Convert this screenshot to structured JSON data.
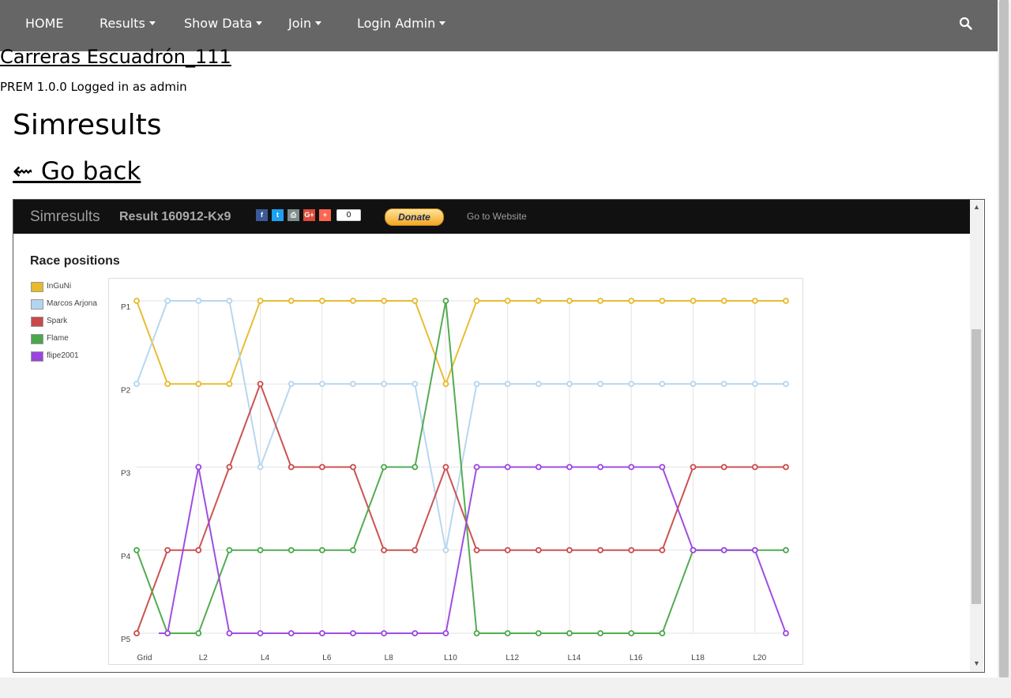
{
  "nav": {
    "items": [
      {
        "label": "HOME",
        "dropdown": false
      },
      {
        "label": "Results",
        "dropdown": true
      },
      {
        "label": "Show Data",
        "dropdown": true
      },
      {
        "label": "Join",
        "dropdown": true
      },
      {
        "label": "Login Admin",
        "dropdown": true
      }
    ],
    "search_icon": "search-icon"
  },
  "site": {
    "title": "Carreras Escuadrón_111",
    "status": "PREM 1.0.0  Logged in as admin"
  },
  "page": {
    "title": "Simresults",
    "go_back": "⇜ Go back"
  },
  "sim": {
    "brand": "Simresults",
    "result": "Result 160912-Kx9",
    "share_count": "0",
    "donate": "Donate",
    "go_website": "Go to Website",
    "share": [
      {
        "icon": "facebook-icon",
        "glyph": "f",
        "color": "#3b5998"
      },
      {
        "icon": "twitter-icon",
        "glyph": "t",
        "color": "#1da1f2"
      },
      {
        "icon": "print-icon",
        "glyph": "⎙",
        "color": "#7f8c8d"
      },
      {
        "icon": "google-plus-icon",
        "glyph": "G+",
        "color": "#dd4b39"
      },
      {
        "icon": "share-plus-icon",
        "glyph": "+",
        "color": "#ff6550"
      }
    ]
  },
  "chart_data": {
    "type": "line",
    "title": "Race positions",
    "x": [
      "Grid",
      "L1",
      "L2",
      "L3",
      "L4",
      "L5",
      "L6",
      "L7",
      "L8",
      "L9",
      "L10",
      "L11",
      "L12",
      "L13",
      "L14",
      "L15",
      "L16",
      "L17",
      "L18",
      "L19",
      "L20",
      "L21"
    ],
    "x_tick_labels": {
      "Grid": "Grid",
      "L2": "L2",
      "L4": "L4",
      "L6": "L6",
      "L8": "L8",
      "L10": "L10",
      "L12": "L12",
      "L14": "L14",
      "L16": "L16",
      "L18": "L18",
      "L20": "L20"
    },
    "y_tick_labels": [
      "P1",
      "P2",
      "P3",
      "P4",
      "P5"
    ],
    "ylim": [
      1,
      5
    ],
    "y_inverted": true,
    "grid": true,
    "legend_position": "left",
    "series": [
      {
        "name": "InGuNi",
        "color": "#e8b92a",
        "values": [
          1,
          2,
          2,
          2,
          1,
          1,
          1,
          1,
          1,
          1,
          2,
          1,
          1,
          1,
          1,
          1,
          1,
          1,
          1,
          1,
          1,
          1
        ]
      },
      {
        "name": "Marcos Arjona",
        "color": "#b3d5ef",
        "values": [
          2,
          1,
          1,
          1,
          3,
          2,
          2,
          2,
          2,
          2,
          4,
          2,
          2,
          2,
          2,
          2,
          2,
          2,
          2,
          2,
          2,
          2
        ]
      },
      {
        "name": "Spark",
        "color": "#c94a4a",
        "values": [
          5,
          4,
          4,
          3,
          2,
          3,
          3,
          3,
          4,
          4,
          3,
          4,
          4,
          4,
          4,
          4,
          4,
          4,
          3,
          3,
          3,
          3
        ]
      },
      {
        "name": "Flame",
        "color": "#4aa84a",
        "values": [
          4,
          5,
          5,
          4,
          4,
          4,
          4,
          4,
          3,
          3,
          1,
          5,
          5,
          5,
          5,
          5,
          5,
          5,
          4,
          4,
          4,
          4
        ]
      },
      {
        "name": "flipe2001",
        "color": "#9b45e0",
        "values": [
          null,
          5,
          3,
          5,
          5,
          5,
          5,
          5,
          5,
          5,
          5,
          3,
          3,
          3,
          3,
          3,
          3,
          3,
          4,
          4,
          4,
          5
        ]
      }
    ]
  }
}
